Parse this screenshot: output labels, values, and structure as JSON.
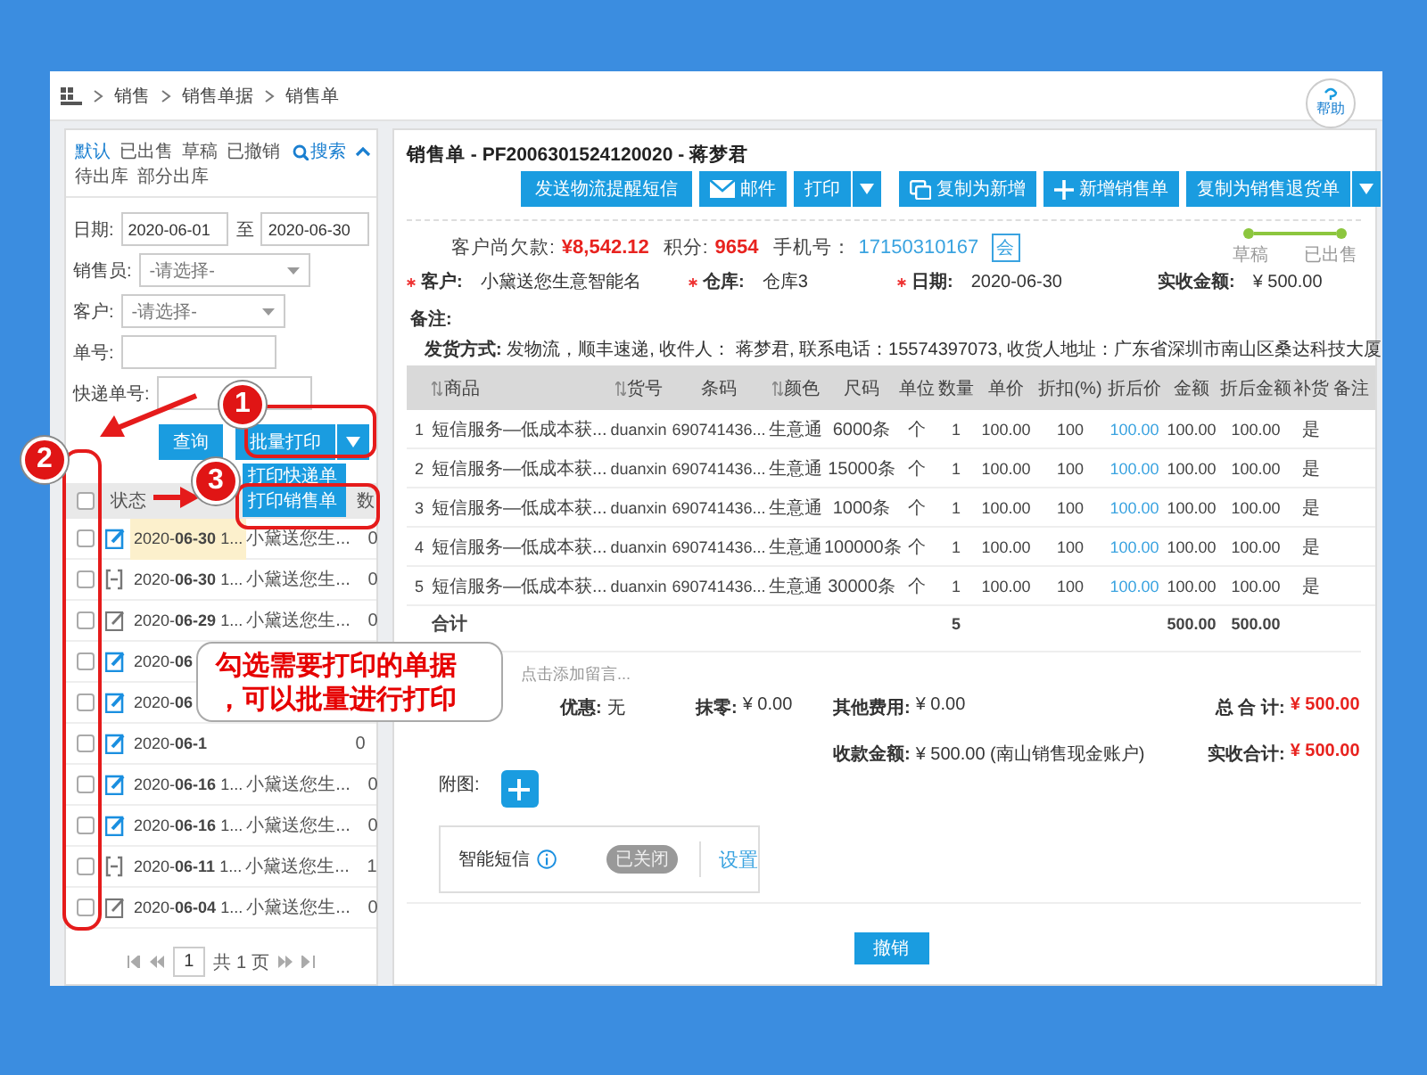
{
  "breadcrumb": [
    "销售",
    "销售单据",
    "销售单"
  ],
  "help": "帮助",
  "filter_tabs": [
    {
      "label": "默认",
      "selected": true
    },
    {
      "label": "已出售",
      "selected": false
    },
    {
      "label": "草稿",
      "selected": false
    },
    {
      "label": "已撤销",
      "selected": false
    },
    {
      "label": "待出库",
      "selected": false
    },
    {
      "label": "部分出库",
      "selected": false
    }
  ],
  "search_link": "搜索",
  "filters": {
    "date_label": "日期:",
    "date_from": "2020-06-01",
    "date_to_label": "至",
    "date_to": "2020-06-30",
    "fields": [
      {
        "label": "销售员:",
        "kind": "select",
        "placeholder": "-请选择-"
      },
      {
        "label": "客户:",
        "kind": "select",
        "placeholder": "-请选择-"
      },
      {
        "label": "单号:",
        "kind": "input"
      },
      {
        "label": "快递单号:",
        "kind": "input"
      }
    ]
  },
  "query_button": "查询",
  "batch_print_button": "批量打印",
  "batch_print_menu": [
    "打印快递单",
    "打印销售单"
  ],
  "select_all": {
    "checked": false
  },
  "list_columns": [
    "状态",
    "数"
  ],
  "orders": [
    {
      "checked": false,
      "selected": true,
      "kind": "sold",
      "date": "2020-**06-30** 1...",
      "customer": "小黛送您生...",
      "count": "0"
    },
    {
      "checked": false,
      "selected": false,
      "kind": "pending",
      "date": "2020-**06-30** 1...",
      "customer": "小黛送您生...",
      "count": "0"
    },
    {
      "checked": false,
      "selected": false,
      "kind": "draft",
      "date": "2020-**06-29** 1...",
      "customer": "小黛送您生...",
      "count": "0"
    },
    {
      "checked": false,
      "selected": false,
      "kind": "sold",
      "date": "2020-**06**"
    },
    {
      "checked": false,
      "selected": false,
      "kind": "sold",
      "date": "2020-**06**"
    },
    {
      "checked": false,
      "selected": false,
      "kind": "sold",
      "date": "2020-**06-1**",
      "count": "0"
    },
    {
      "checked": false,
      "selected": false,
      "kind": "sold",
      "date": "2020-**06-16** 1...",
      "customer": "小黛送您生...",
      "count": "0"
    },
    {
      "checked": false,
      "selected": false,
      "kind": "sold",
      "date": "2020-**06-16** 1...",
      "customer": "小黛送您生...",
      "count": "0"
    },
    {
      "checked": false,
      "selected": false,
      "kind": "pending",
      "date": "2020-**06-11** 1...",
      "customer": "小黛送您生...",
      "count": "1"
    },
    {
      "checked": false,
      "selected": false,
      "kind": "draft",
      "date": "2020-**06-04** 1...",
      "customer": "小黛送您生...",
      "count": "0"
    }
  ],
  "pager": {
    "page": "1",
    "total": "共 1 页"
  },
  "order": {
    "title": "销售单 - PF2006301524120020 - 蒋梦君",
    "actions": [
      {
        "label": "发送物流提醒短信",
        "kind": "plain"
      },
      {
        "label": "邮件",
        "kind": "mail"
      },
      {
        "label": "打印",
        "kind": "split"
      },
      {
        "label": "复制为新增",
        "kind": "copy"
      },
      {
        "label": "新增销售单",
        "kind": "add"
      },
      {
        "label": "复制为销售退货单",
        "kind": "split"
      }
    ],
    "summary": {
      "debt_label": "客户尚欠款:",
      "debt": "¥8,542.12",
      "points_label": "积分:",
      "points": "9654",
      "phone_label": "手机号：",
      "phone": "17150310167",
      "member_badge": "会"
    },
    "progress": [
      {
        "label": "草稿",
        "done": true
      },
      {
        "label": "已出售",
        "done": true
      }
    ],
    "fields": [
      {
        "label": "客户:",
        "value": "小黛送您生意智能名",
        "required": true
      },
      {
        "label": "仓库:",
        "value": "仓库3",
        "required": true
      },
      {
        "label": "日期:",
        "value": "2020-06-30",
        "required": true
      },
      {
        "label": "实收金额:",
        "value": "¥ 500.00",
        "required": false
      }
    ],
    "remark_label": "备注:",
    "shipping": "**发货方式:** 发物流，顺丰速递, 收件人： 蒋梦君, 联系电话：15574397073, 收货人地址：广东省深圳市南山区桑达科技大厦",
    "table": {
      "columns": [
        {
          "label": "商品",
          "sortable": true,
          "kind": "name"
        },
        {
          "label": "货号",
          "sortable": true,
          "kind": "text"
        },
        {
          "label": "条码",
          "sortable": false,
          "kind": "text"
        },
        {
          "label": "颜色",
          "sortable": true,
          "kind": "text"
        },
        {
          "label": "尺码",
          "sortable": false,
          "kind": "text"
        },
        {
          "label": "单位",
          "sortable": false,
          "kind": "text"
        },
        {
          "label": "数量",
          "sortable": false,
          "kind": "text",
          "total": "5"
        },
        {
          "label": "单价",
          "sortable": false,
          "kind": "text"
        },
        {
          "label": "折扣(%)",
          "sortable": false,
          "kind": "text"
        },
        {
          "label": "折后价",
          "sortable": false,
          "kind": "link"
        },
        {
          "label": "金额",
          "sortable": false,
          "kind": "text",
          "total": "500.00"
        },
        {
          "label": "折后金额",
          "sortable": false,
          "kind": "text",
          "total": "500.00"
        },
        {
          "label": "补货",
          "sortable": false,
          "kind": "text"
        },
        {
          "label": "备注",
          "sortable": false,
          "kind": "text"
        }
      ],
      "rows": [
        {
          "no": "1",
          "cells": [
            "短信服务—低成本获...",
            "duanxin",
            "690741436...",
            "生意通",
            "6000条",
            "个",
            "1",
            "100.00",
            "100",
            "100.00",
            "100.00",
            "100.00",
            "是"
          ]
        },
        {
          "no": "2",
          "cells": [
            "短信服务—低成本获...",
            "duanxin",
            "690741436...",
            "生意通",
            "15000条",
            "个",
            "1",
            "100.00",
            "100",
            "100.00",
            "100.00",
            "100.00",
            "是"
          ]
        },
        {
          "no": "3",
          "cells": [
            "短信服务—低成本获...",
            "duanxin",
            "690741436...",
            "生意通",
            "1000条",
            "个",
            "1",
            "100.00",
            "100",
            "100.00",
            "100.00",
            "100.00",
            "是"
          ]
        },
        {
          "no": "4",
          "cells": [
            "短信服务—低成本获...",
            "duanxin",
            "690741436...",
            "生意通",
            "100000条",
            "个",
            "1",
            "100.00",
            "100",
            "100.00",
            "100.00",
            "100.00",
            "是"
          ]
        },
        {
          "no": "5",
          "cells": [
            "短信服务—低成本获...",
            "duanxin",
            "690741436...",
            "生意通",
            "30000条",
            "个",
            "1",
            "100.00",
            "100",
            "100.00",
            "100.00",
            "100.00",
            "是"
          ]
        }
      ],
      "total_label": "合计"
    },
    "message_placeholder": "点击添加留言...",
    "charges": [
      {
        "label": "优惠:",
        "value": "无"
      },
      {
        "label": "抹零:",
        "value": "¥ 0.00"
      },
      {
        "label": "其他费用:",
        "value": "¥ 0.00"
      }
    ],
    "total": {
      "label": "总 合 计:",
      "value": "¥ 500.00"
    },
    "payment": {
      "label": "收款金额:",
      "value": "¥ 500.00 (南山销售现金账户)"
    },
    "received_total": {
      "label": "实收合计:",
      "value": "¥ 500.00"
    },
    "attachment_label": "附图:",
    "sms": {
      "label": "智能短信",
      "on": false,
      "toggle_text": "已关闭",
      "settings_link": "设置"
    },
    "cancel_button": "撤销"
  },
  "annotations": {
    "markers": [
      "1",
      "2",
      "3"
    ],
    "callout": "勾选需要打印的单据，可以批量进行打印"
  }
}
